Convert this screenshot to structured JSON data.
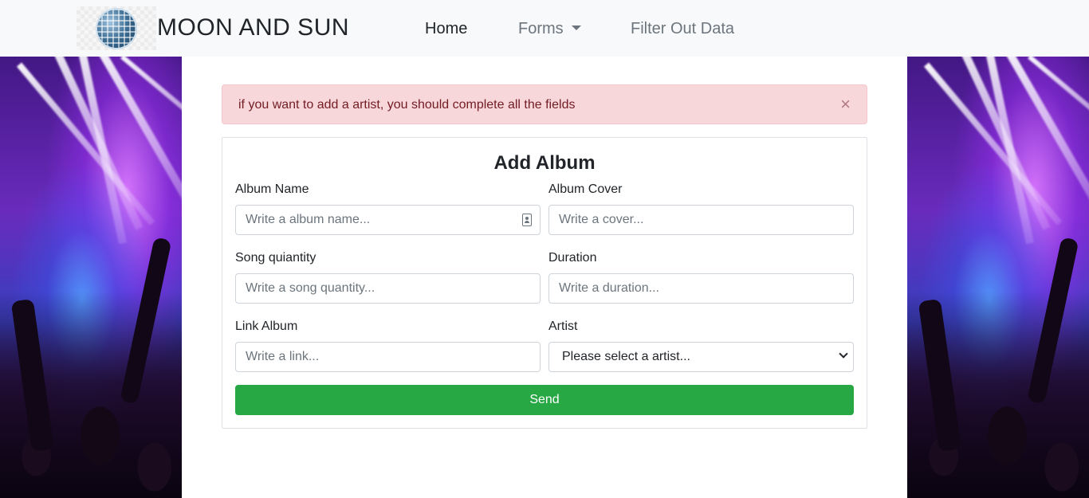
{
  "navbar": {
    "brand": "MOON AND SUN",
    "links": {
      "home": "Home",
      "forms": "Forms",
      "filter": "Filter Out Data"
    }
  },
  "alert": {
    "message": "if you want to add a artist, you should complete all the fields",
    "close": "×"
  },
  "form": {
    "title": "Add Album",
    "album_name": {
      "label": "Album Name",
      "placeholder": "Write a album name..."
    },
    "album_cover": {
      "label": "Album Cover",
      "placeholder": "Write a cover..."
    },
    "song_quantity": {
      "label": "Song quiantity",
      "placeholder": "Write a song quantity..."
    },
    "duration": {
      "label": "Duration",
      "placeholder": "Write a duration..."
    },
    "link_album": {
      "label": "Link Album",
      "placeholder": "Write a link..."
    },
    "artist": {
      "label": "Artist",
      "selected": "Please select a artist..."
    },
    "send": "Send"
  },
  "colors": {
    "navbar_bg": "#f8f9fa",
    "alert_bg": "#f8d7da",
    "alert_text": "#721c24",
    "send_bg": "#28a745"
  },
  "icons": {
    "logo": "disco-ball-icon",
    "field_contact": "contact-card-icon",
    "forms_caret": "caret-down-icon",
    "select_chevron": "chevron-down-icon",
    "alert_close": "close-icon"
  }
}
